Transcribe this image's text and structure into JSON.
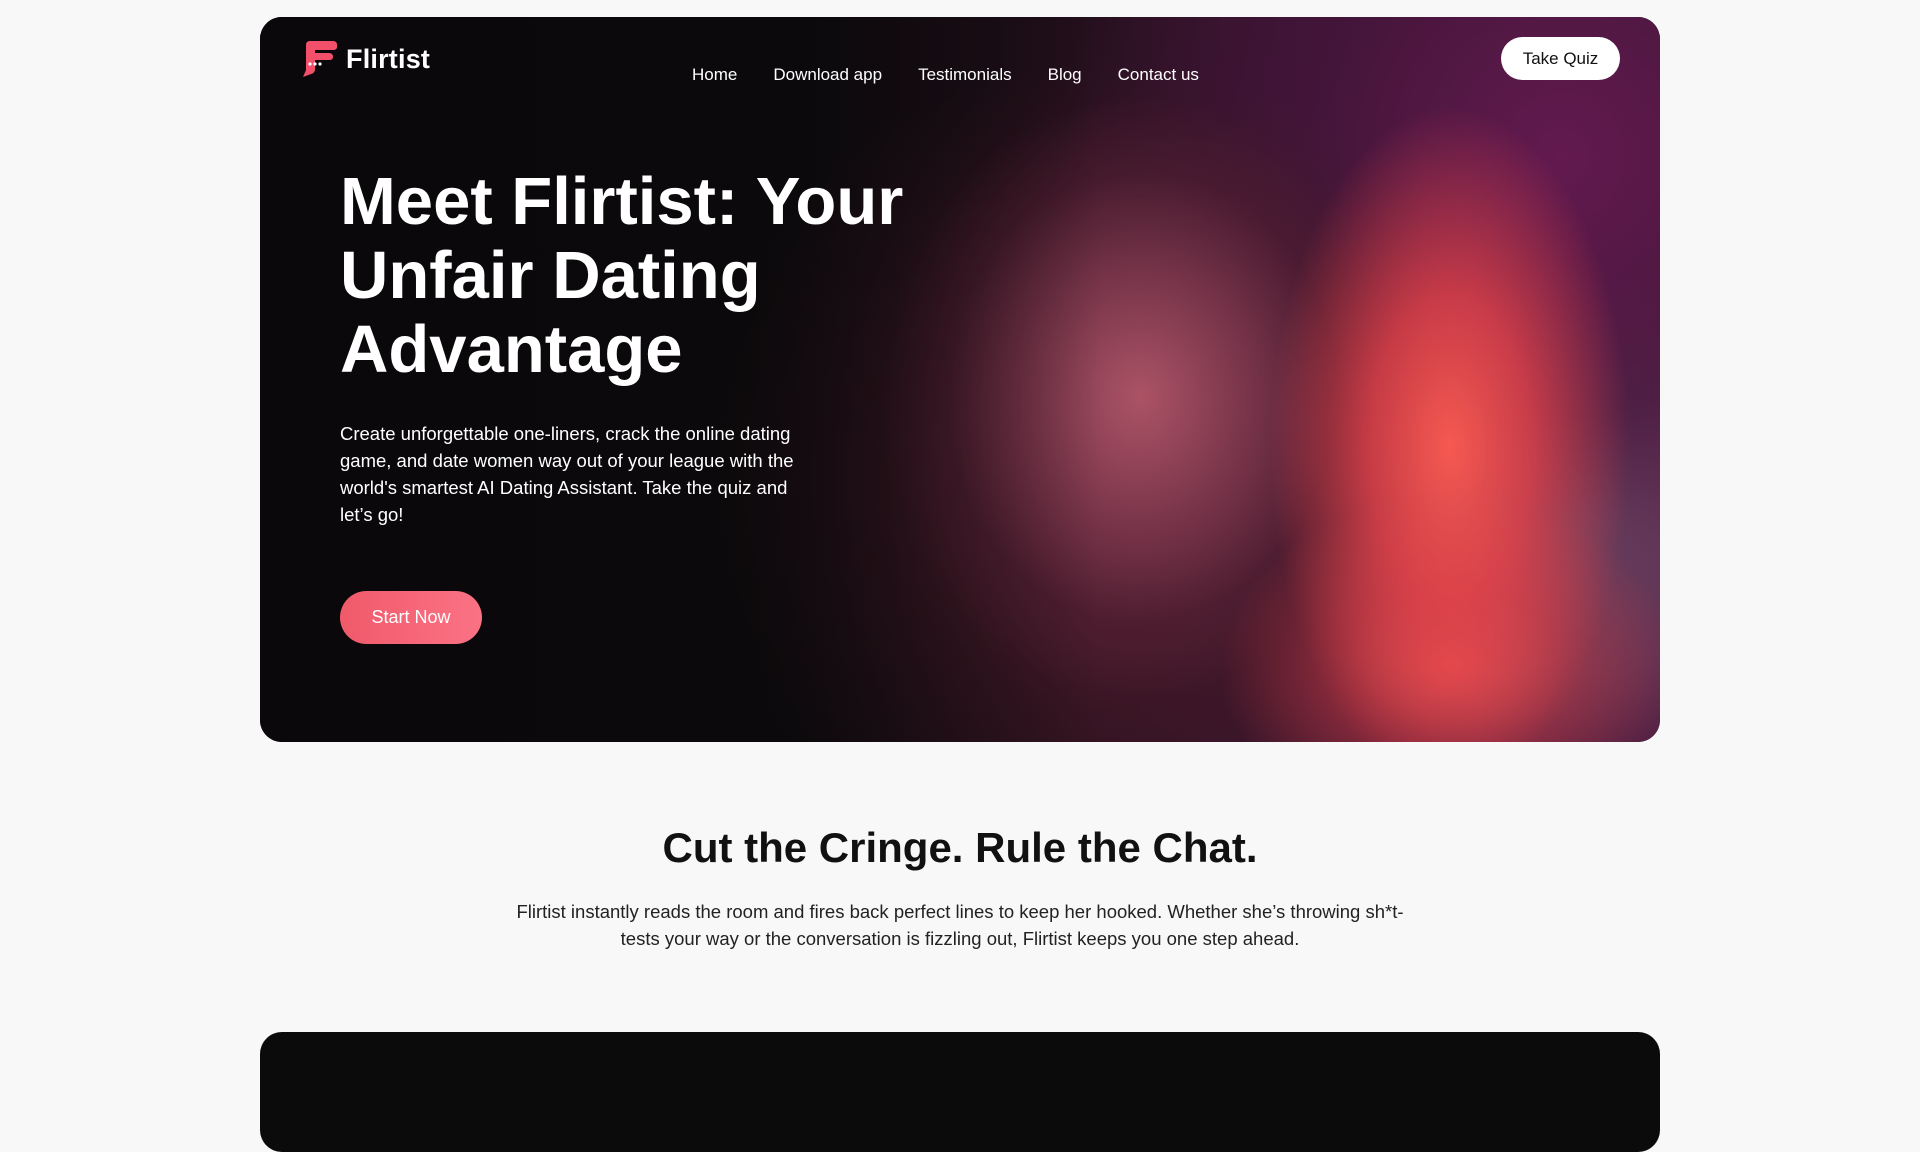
{
  "brand": {
    "name": "Flirtist",
    "icon": "flirtist-logo-icon",
    "accent_color": "#f2506a"
  },
  "nav": {
    "items": [
      {
        "label": "Home"
      },
      {
        "label": "Download app"
      },
      {
        "label": "Testimonials"
      },
      {
        "label": "Blog"
      },
      {
        "label": "Contact us"
      }
    ],
    "cta_label": "Take Quiz"
  },
  "hero": {
    "title": "Meet Flirtist: Your Unfair Dating Advantage",
    "description": "Create unforgettable one-liners, crack the online dating game, and date women way out of your league with the world's smartest AI Dating Assistant. Take the quiz and let’s go!",
    "cta_label": "Start Now",
    "cta_color": "#f5647a"
  },
  "feature": {
    "title": "Cut the Cringe. Rule the Chat.",
    "description": "Flirtist instantly reads the room and fires back perfect lines to keep her hooked. Whether she’s throwing sh*t-tests your way or the conversation is fizzling out, Flirtist keeps you one step ahead."
  }
}
